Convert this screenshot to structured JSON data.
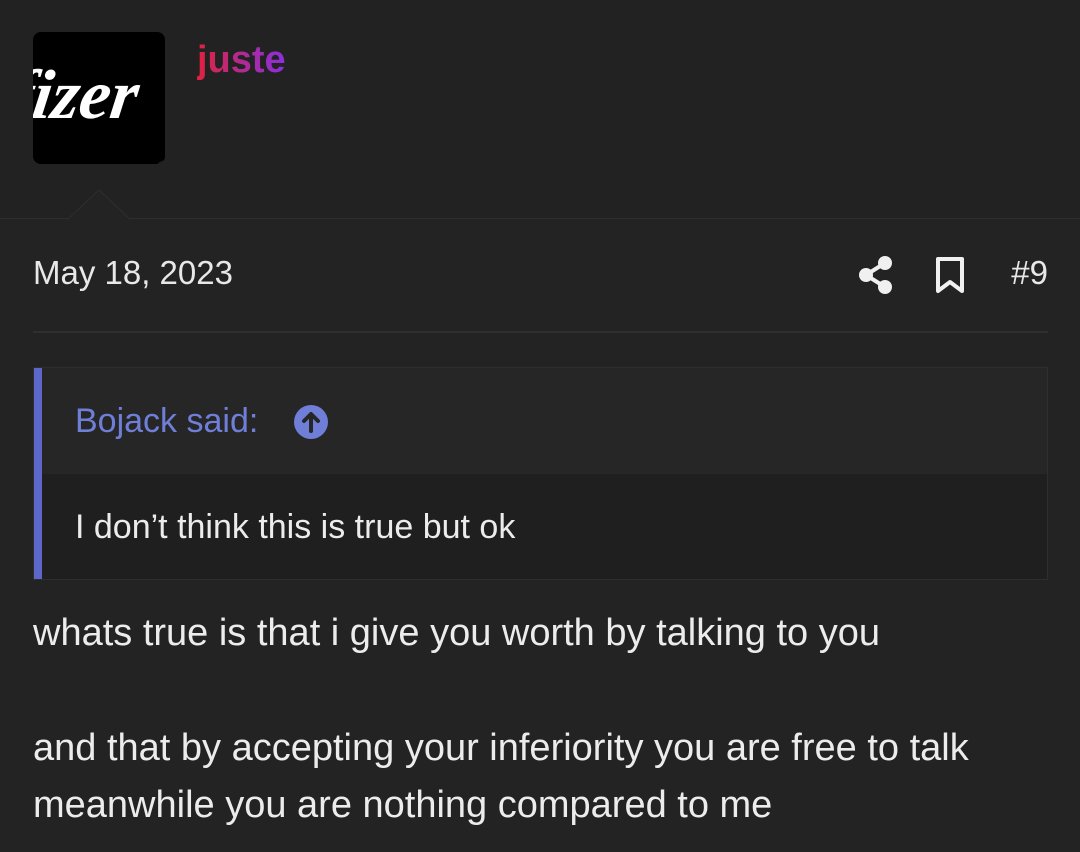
{
  "user": {
    "name": "juste",
    "avatar_text": "fizer",
    "status": "online"
  },
  "post": {
    "date": "May 18, 2023",
    "number": "#9"
  },
  "quote": {
    "author_label": "Bojack said:",
    "text": "I don’t think this is true but ok"
  },
  "body": {
    "paragraphs": [
      "whats true is that i give you worth by talking to you",
      "and that by accepting your inferiority you are free to talk meanwhile you are nothing compared to me"
    ]
  },
  "colors": {
    "background": "#232323",
    "quote_accent": "#5c67c9",
    "quote_author": "#6f7fd8",
    "online": "#7dbb00",
    "username_gradient": [
      "#e0213f",
      "#8b2fe0"
    ]
  },
  "icons": {
    "share": "share-icon",
    "bookmark": "bookmark-icon",
    "quote_jump": "arrow-up-circle-icon"
  }
}
